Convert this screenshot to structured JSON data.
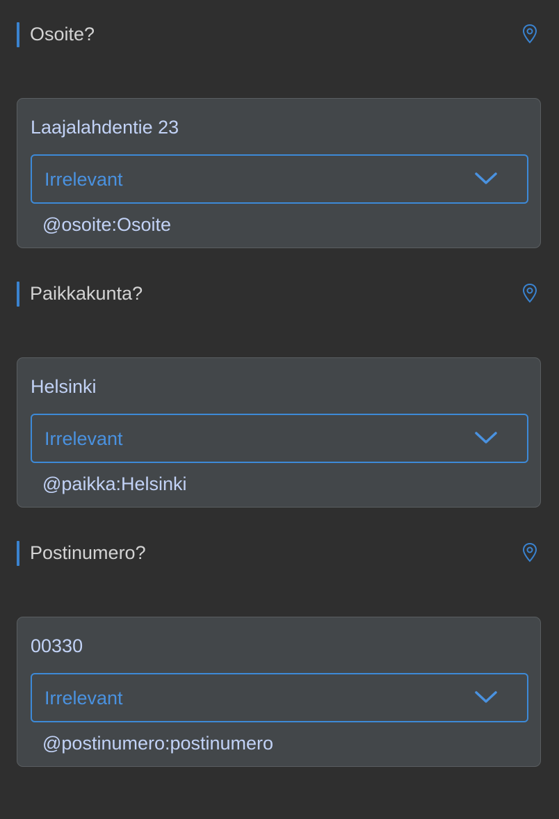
{
  "colors": {
    "background": "#2f2f2f",
    "accent": "#3d8ad8",
    "card_background": "#43474a",
    "value_text": "#c2d2f6",
    "label_text": "#d3d3d3"
  },
  "fields": [
    {
      "question": "Osoite?",
      "icon": "location-pin-icon",
      "value": "Laajalahdentie 23",
      "select_value": "Irrelevant",
      "variable": "@osoite:Osoite"
    },
    {
      "question": "Paikkakunta?",
      "icon": "location-pin-icon",
      "value": "Helsinki",
      "select_value": "Irrelevant",
      "variable": "@paikka:Helsinki"
    },
    {
      "question": "Postinumero?",
      "icon": "location-pin-icon",
      "value": "00330",
      "select_value": "Irrelevant",
      "variable": "@postinumero:postinumero"
    }
  ]
}
